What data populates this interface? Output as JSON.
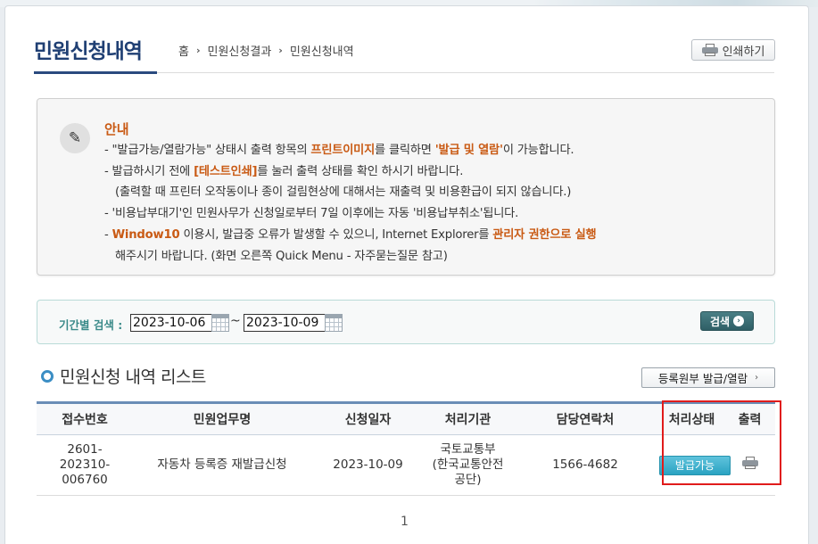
{
  "header": {
    "title": "민원신청내역",
    "breadcrumb": [
      "홈",
      "민원신청결과",
      "민원신청내역"
    ],
    "breadcrumb_sep": "›",
    "print_label": "인쇄하기"
  },
  "notice": {
    "title": "안내",
    "lines": [
      {
        "p1": "- \"발급가능/열람가능\" 상태시 출력 항목의 ",
        "e1": "프린트이미지",
        "p2": "를 클릭하면 ",
        "e2": "'발급 및 열람'",
        "p3": "이 가능합니다."
      },
      {
        "p1": "- 발급하시기 전에 ",
        "e1": "[테스트인쇄]",
        "p2": "를 눌러 출력 상태를 확인 하시기 바랍니다."
      },
      {
        "p1": "(출력할 때 프린터 오작동이나 종이 걸림현상에 대해서는 재출력 및 비용환급이 되지 않습니다.)"
      },
      {
        "p1": "- '비용납부대기'인 민원사무가 신청일로부터 7일 이후에는 자동 '비용납부취소'됩니다."
      },
      {
        "p1": "- ",
        "e1": "Window10",
        "p2": " 이용시, 발급중 오류가 발생할 수 있으니, Internet Explorer를 ",
        "e2": "관리자 권한으로 실행"
      },
      {
        "p1": "해주시기 바랍니다. (화면 오른쪽 Quick Menu - 자주묻는질문 참고)"
      }
    ]
  },
  "search": {
    "label": "기간별 검색 :",
    "from_date": "2023-10-06",
    "to_date": "2023-10-09",
    "tilde": "~",
    "button_label": "검색",
    "button_arrow": "›"
  },
  "list": {
    "title": "민원신청 내역 리스트",
    "register_button": "등록원부 발급/열람",
    "register_arrow": "›",
    "columns": [
      "접수번호",
      "민원업무명",
      "신청일자",
      "처리기관",
      "담당연락처",
      "처리상태",
      "출력"
    ],
    "rows": [
      {
        "receipt_no": [
          "2601-",
          "202310-",
          "006760"
        ],
        "service": "자동차 등록증 재발급신청",
        "date": "2023-10-09",
        "agency": [
          "국토교통부",
          "(한국교통안전",
          "공단)"
        ],
        "contact": "1566-4682",
        "status": "발급가능",
        "print_icon": "printer-icon"
      }
    ],
    "pagination": [
      "1"
    ]
  },
  "colors": {
    "title": "#1f3f73",
    "emphasis": "#c95a14",
    "search_label": "#3a8a89",
    "status_button": "#2aa3c2",
    "highlight_box": "#e01b1b"
  }
}
